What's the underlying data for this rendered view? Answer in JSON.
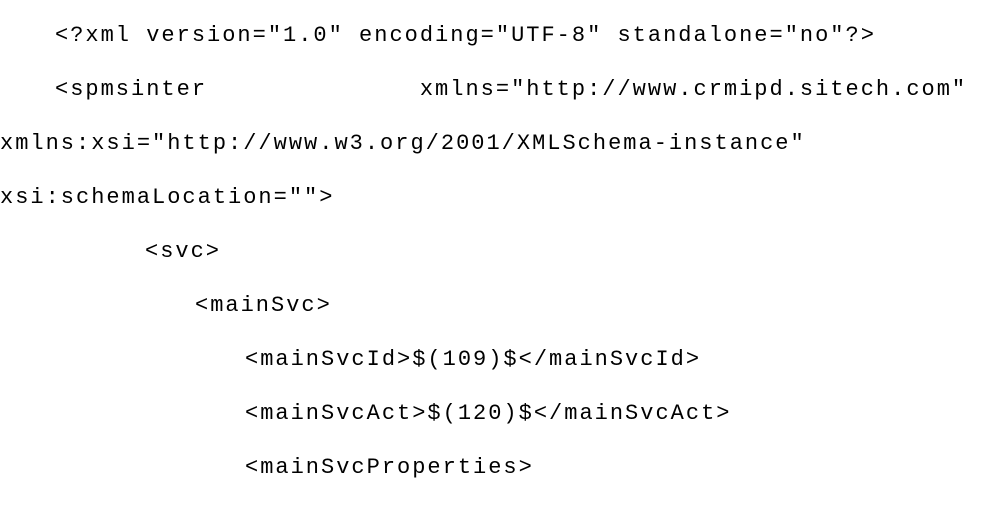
{
  "code": {
    "line1": "<?xml version=\"1.0\" encoding=\"UTF-8\" standalone=\"no\"?>",
    "line2": "<spmsinter              xmlns=\"http://www.crmipd.sitech.com\"",
    "line3": "xmlns:xsi=\"http://www.w3.org/2001/XMLSchema-instance\"",
    "line4": "xsi:schemaLocation=\"\">",
    "line5": "<svc>",
    "line6": "<mainSvc>",
    "line7": "<mainSvcId>$(109)$</mainSvcId>",
    "line8": "<mainSvcAct>$(120)$</mainSvcAct>",
    "line9": "<mainSvcProperties>"
  }
}
